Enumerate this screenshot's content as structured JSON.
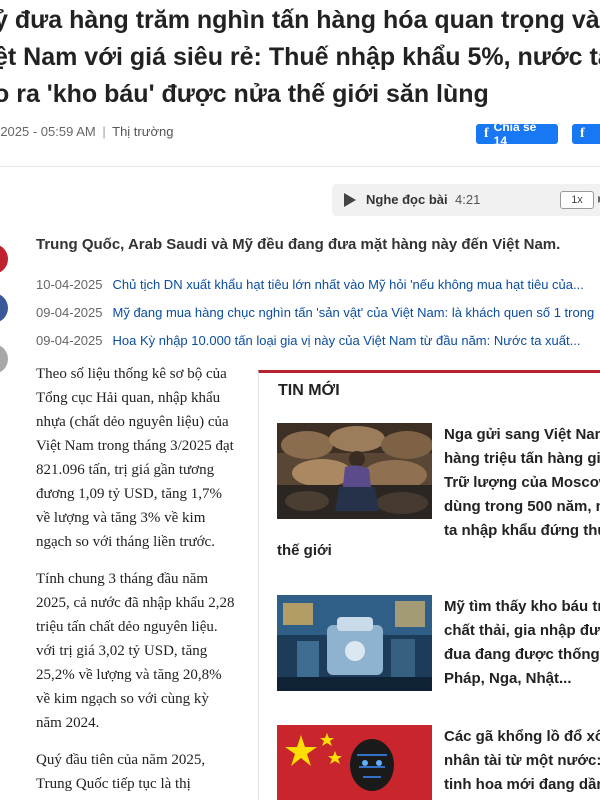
{
  "article": {
    "headline_lines": [
      "ỷ đưa hàng trăm nghìn tấn hàng hóa quan trọng và",
      "ệt Nam với giá siêu rẻ: Thuế nhập khẩu 5%, nước ta",
      "o ra 'kho báu' được nửa thế giới săn lùng"
    ],
    "date": "-2025 - 05:59 AM",
    "separator": "|",
    "category": "Thị trường",
    "share_label": "Chia sẻ 14",
    "share_label_2": "f",
    "audio": {
      "label": "Nghe đọc bài",
      "duration": "4:21",
      "speed": "1x"
    },
    "sapo": "Trung Quốc, Arab Saudi và Mỹ đều đang đưa mặt hàng này đến Việt Nam.",
    "related": [
      {
        "date": "10-04-2025",
        "title": "Chủ tịch DN xuất khẩu hạt tiêu lớn nhất vào Mỹ hỏi 'nếu không mua hạt tiêu của..."
      },
      {
        "date": "09-04-2025",
        "title": "Mỹ đang mua hàng chục nghìn tấn 'sản vật' của Việt Nam: là khách quen số 1 trong"
      },
      {
        "date": "09-04-2025",
        "title": "Hoa Kỳ nhập 10.000 tấn loại gia vị này của Việt Nam từ đầu năm: Nước ta xuất..."
      }
    ],
    "body_paragraphs": [
      "Theo số liệu thống kê sơ bộ của Tổng cục Hải quan, nhập khẩu nhựa (chất dẻo nguyên liệu) của Việt Nam trong tháng 3/2025 đạt 821.096 tấn, trị giá gần tương đương 1,09 tỷ USD, tăng 1,7% về lượng và tăng 3% về kim ngạch so với tháng liền trước.",
      "Tính chung 3 tháng đầu năm 2025, cả nước đã nhập khẩu 2,28 triệu tấn chất dẻo nguyên liệu. với trị giá 3,02 tỷ USD, tăng 25,2% về lượng và tăng 20,8% về kim ngạch so với cùng kỳ năm 2024.",
      "Quý đầu tiên của năm 2025, Trung Quốc tiếp tục là thị"
    ]
  },
  "sidebar": {
    "title": "TIN MỚI",
    "items": [
      {
        "title_lines": [
          "Nga gửi sang Việt Nam",
          "hàng triệu tấn hàng gi",
          "Trữ lượng của Moscow",
          "dùng trong 500 năm, n",
          "ta nhập khẩu đứng thứ"
        ],
        "tail": "thế giới"
      },
      {
        "title_lines": [
          "Mỹ tìm thấy kho báu tr",
          "chất thải, gia nhập đườ",
          "đua đang được thống t",
          "Pháp, Nga, Nhật..."
        ],
        "tail": ""
      },
      {
        "title_lines": [
          "Các gã khổng lồ đổ xô",
          "nhân tài từ một nước: C",
          "tinh hoa mới đang dần"
        ],
        "tail": ""
      }
    ]
  },
  "colors": {
    "accent": "#b8212f",
    "link": "#0b4da2",
    "facebook": "#1877f2"
  },
  "icons": [
    "play-icon",
    "facebook-icon",
    "forward-icon"
  ]
}
